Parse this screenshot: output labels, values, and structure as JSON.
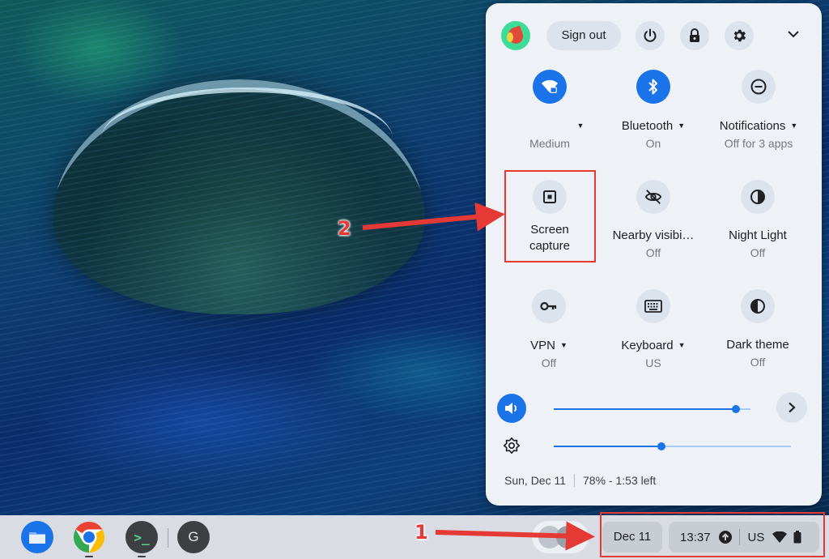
{
  "quick_settings": {
    "header": {
      "sign_out_label": "Sign out",
      "icons": [
        "avatar",
        "power-icon",
        "lock-icon",
        "gear-icon",
        "chevron-down-icon"
      ]
    },
    "tiles": [
      {
        "id": "wifi",
        "label": "",
        "sub": "Medium",
        "active": true,
        "has_menu": true,
        "icon": "wifi-lock-icon"
      },
      {
        "id": "bluetooth",
        "label": "Bluetooth",
        "sub": "On",
        "active": true,
        "has_menu": true,
        "icon": "bluetooth-icon"
      },
      {
        "id": "notifications",
        "label": "Notifications",
        "sub": "Off for 3 apps",
        "active": false,
        "has_menu": true,
        "icon": "do-not-disturb-icon"
      },
      {
        "id": "screen-capture",
        "label_line1": "Screen",
        "label_line2": "capture",
        "active": false,
        "icon": "screen-capture-icon"
      },
      {
        "id": "nearby",
        "label": "Nearby visibi…",
        "sub": "Off",
        "active": false,
        "icon": "eye-off-icon"
      },
      {
        "id": "night-light",
        "label": "Night Light",
        "sub": "Off",
        "active": false,
        "icon": "half-circle-icon"
      },
      {
        "id": "vpn",
        "label": "VPN",
        "sub": "Off",
        "active": false,
        "has_menu": true,
        "icon": "key-icon"
      },
      {
        "id": "keyboard",
        "label": "Keyboard",
        "sub": "US",
        "active": false,
        "has_menu": true,
        "icon": "keyboard-icon"
      },
      {
        "id": "dark-theme",
        "label": "Dark theme",
        "sub": "Off",
        "active": false,
        "icon": "contrast-icon"
      }
    ],
    "sliders": {
      "volume_level": 0.925,
      "brightness_level": 0.455
    },
    "footer": {
      "date": "Sun, Dec 11",
      "battery": "78% - 1:53 left"
    }
  },
  "shelf": {
    "apps": [
      "files-icon",
      "chrome-icon",
      "terminal-icon",
      "g-app-icon"
    ],
    "g_app_label": "G",
    "terminal_label": ">_",
    "date_label": "Dec 11",
    "time_label": "13:37",
    "keyboard_layout": "US"
  },
  "annotations": {
    "label_1": "1",
    "label_2": "2"
  },
  "colors": {
    "accent": "#1a73e8",
    "annotation_red": "#e53935",
    "panel_bg": "#eef1f6"
  }
}
